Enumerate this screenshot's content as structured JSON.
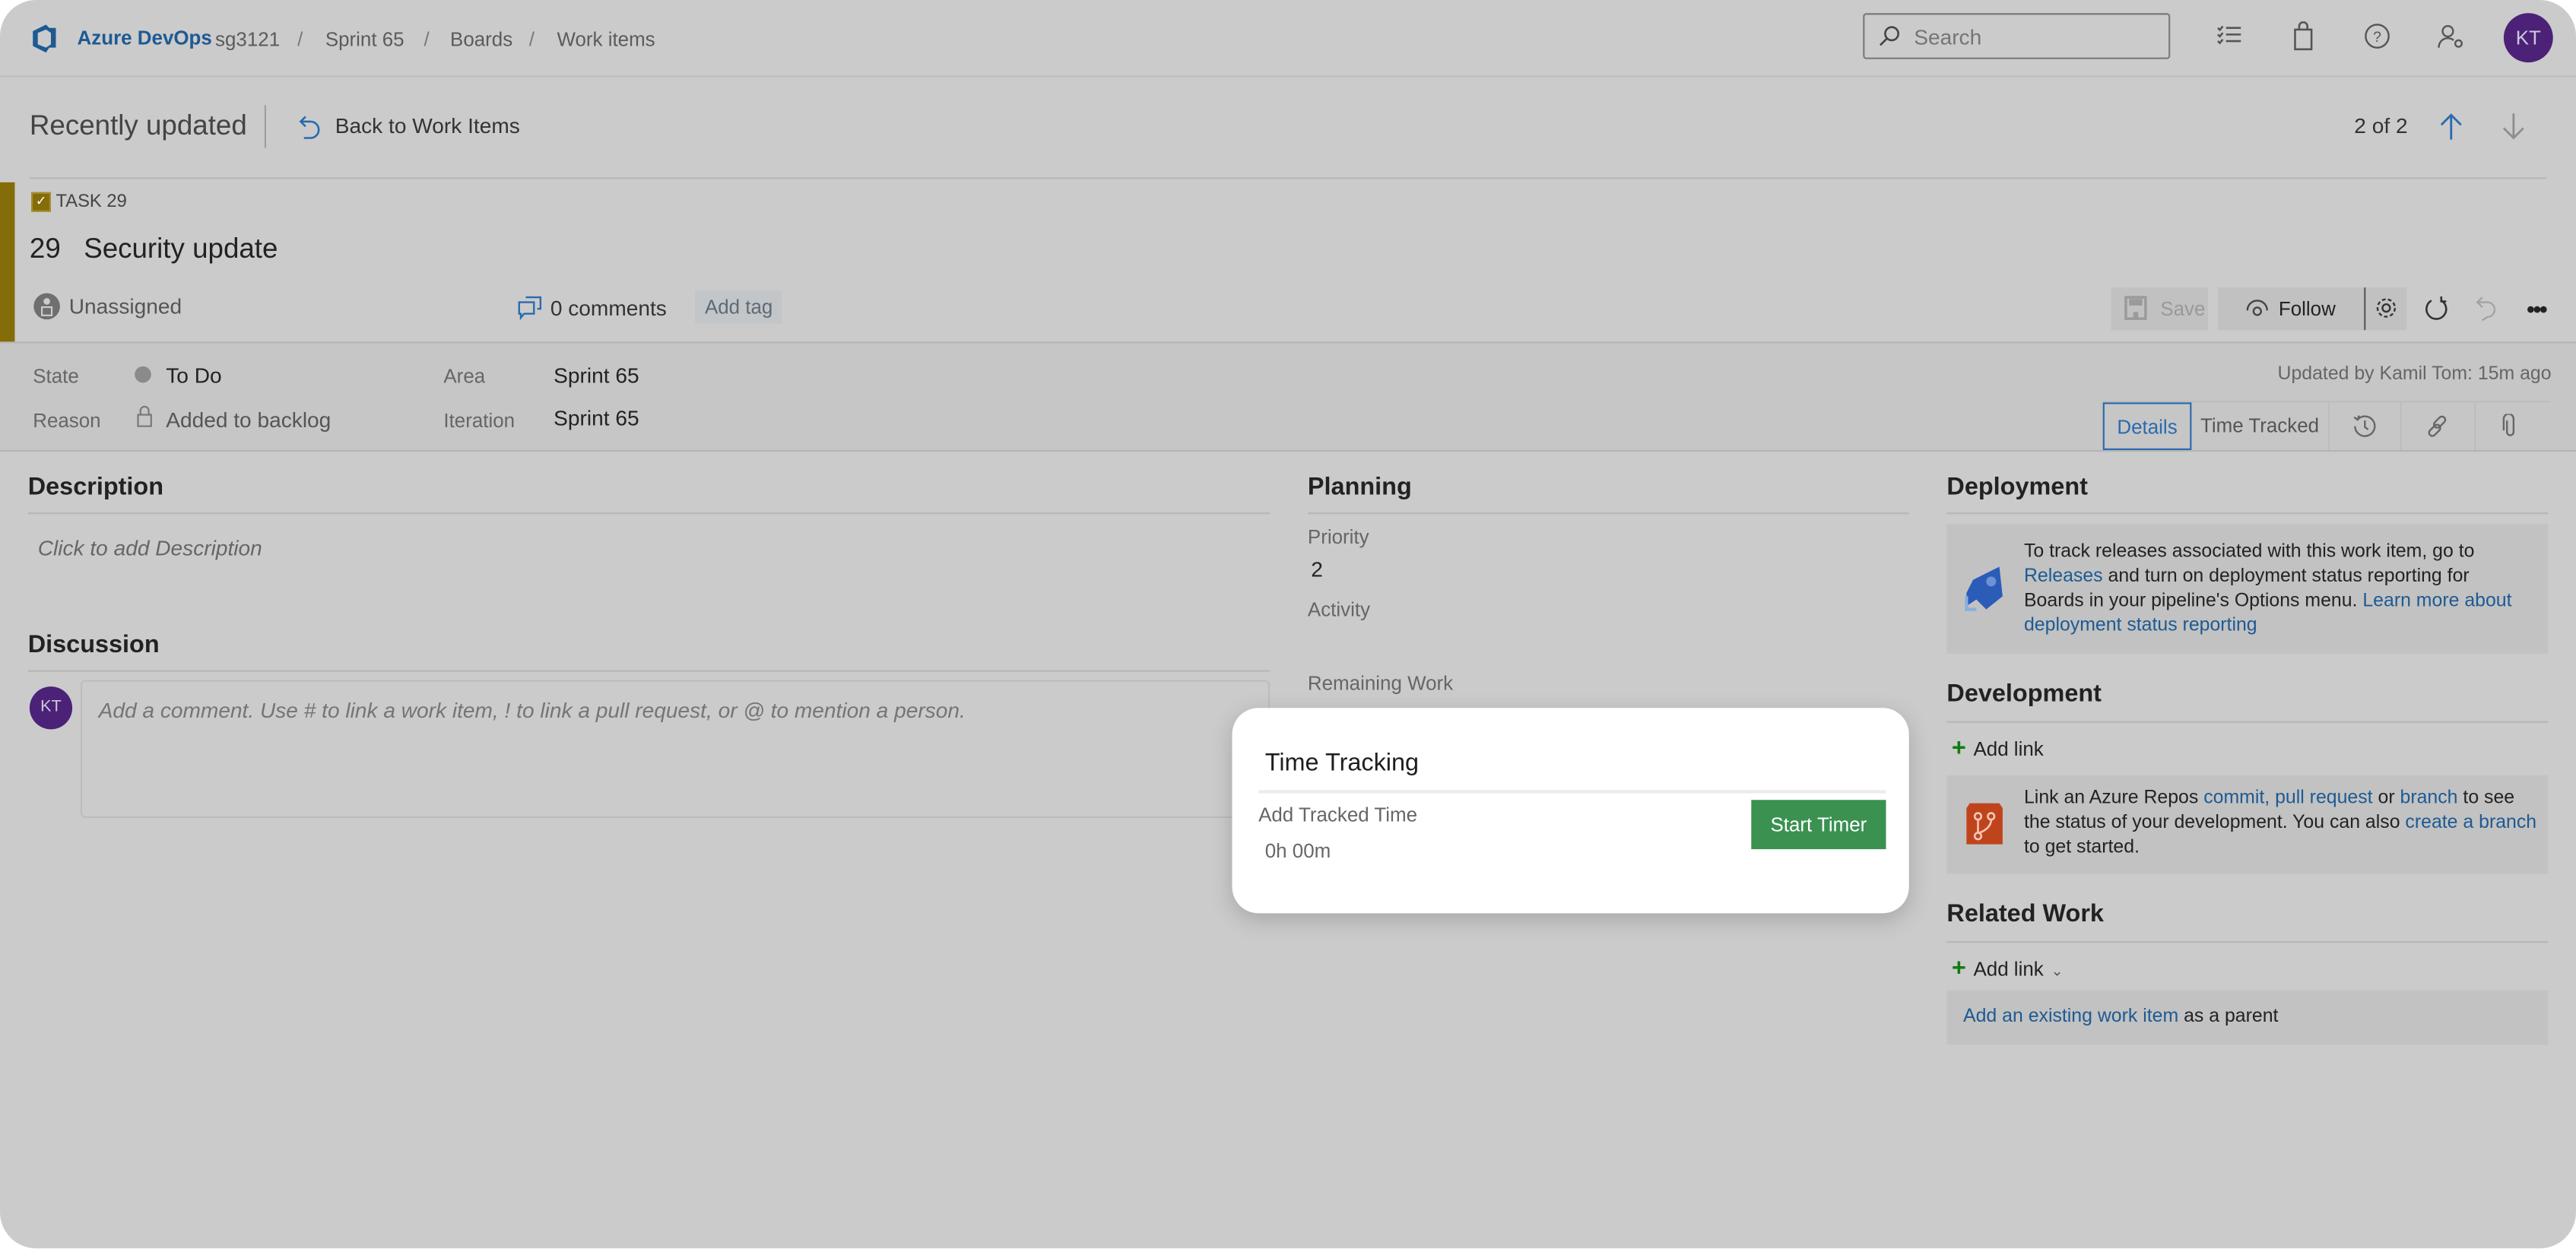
{
  "topbar": {
    "brand": "Azure DevOps",
    "breadcrumbs": [
      "sg3121",
      "Sprint 65",
      "Boards",
      "Work items"
    ],
    "breadcrumb_separator": "/",
    "search_placeholder": "Search",
    "icons": [
      "task-list-icon",
      "shopping-bag-icon",
      "help-icon",
      "user-settings-icon"
    ],
    "avatar_initials": "KT",
    "avatar_color": "#4b2277"
  },
  "subheader": {
    "title": "Recently updated",
    "back_label": "Back to Work Items",
    "pager": "2 of 2"
  },
  "work_item": {
    "type_label": "TASK 29",
    "type_color": "#846c08",
    "id": "29",
    "title": "Security update",
    "assignee": "Unassigned",
    "comments": "0 comments",
    "add_tag": "Add tag",
    "toolbar": {
      "save": "Save",
      "follow": "Follow"
    },
    "fields": {
      "state_label": "State",
      "state_value": "To Do",
      "reason_label": "Reason",
      "reason_value": "Added to backlog",
      "area_label": "Area",
      "area_value": "Sprint 65",
      "iteration_label": "Iteration",
      "iteration_value": "Sprint 65"
    },
    "updated_by": "Updated by Kamil Tom: 15m ago",
    "tabs": [
      {
        "label": "Details",
        "active": true
      },
      {
        "label": "Time Tracked",
        "active": false
      }
    ]
  },
  "description": {
    "heading": "Description",
    "placeholder": "Click to add Description"
  },
  "discussion": {
    "heading": "Discussion",
    "avatar_initials": "KT",
    "placeholder": "Add a comment. Use # to link a work item, ! to link a pull request, or @ to mention a person."
  },
  "planning": {
    "heading": "Planning",
    "priority_label": "Priority",
    "priority_value": "2",
    "activity_label": "Activity",
    "remaining_label": "Remaining Work"
  },
  "deployment": {
    "heading": "Deployment",
    "text_1": "To track releases associated with this work item, go to ",
    "link_releases": "Releases",
    "text_2": " and turn on deployment status reporting for Boards in your pipeline's Options menu. ",
    "link_learn": "Learn more about deployment status reporting"
  },
  "development": {
    "heading": "Development",
    "add_link": "Add link",
    "text_1": "Link an Azure Repos ",
    "link_commit": "commit,",
    "link_pr": "pull request",
    "text_or": " or ",
    "link_branch": "branch",
    "text_2": " to see the status of your development. You can also ",
    "link_create": "create a branch",
    "text_3": " to get started."
  },
  "related_work": {
    "heading": "Related Work",
    "add_link": "Add link",
    "link_existing": "Add an existing work item",
    "text_parent": " as a parent"
  },
  "time_tracking_dialog": {
    "title": "Time Tracking",
    "label": "Add Tracked Time",
    "value": "0h 00m",
    "start_button": "Start Timer",
    "button_color": "#3a9150"
  }
}
